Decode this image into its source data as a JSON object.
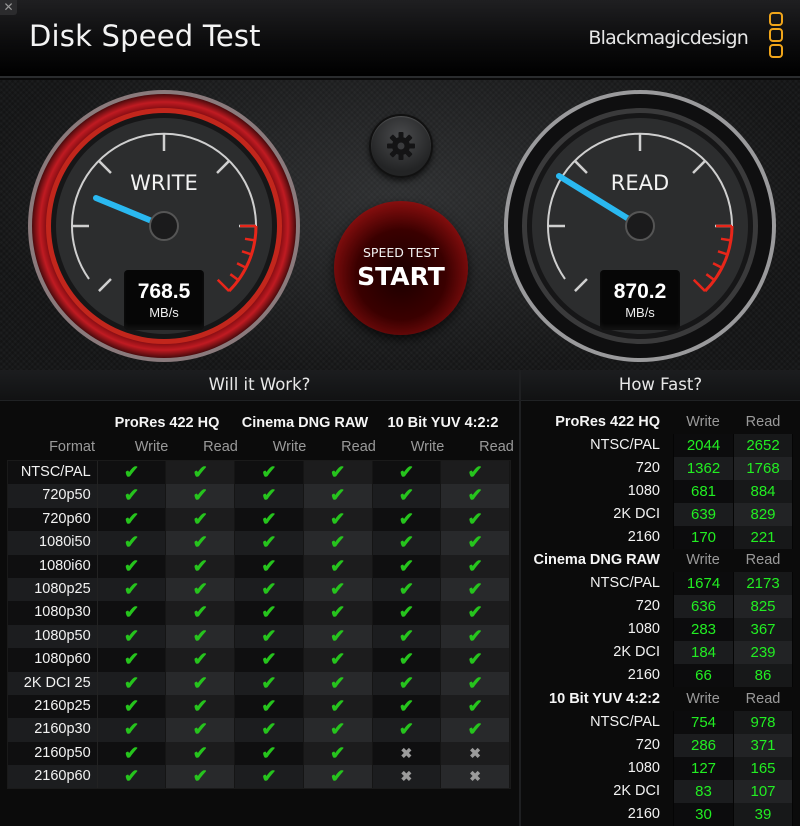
{
  "window": {
    "title": "Disk Speed Test",
    "close_icon": "close-icon",
    "brand": "Blackmagicdesign",
    "brand_logo_color": "#f0a51a"
  },
  "gauges": {
    "write": {
      "label": "WRITE",
      "value": "768.5",
      "unit": "MB/s",
      "ring_color": "#b1141a",
      "needle_color": "#2ab8f0"
    },
    "read": {
      "label": "READ",
      "value": "870.2",
      "unit": "MB/s",
      "ring_color": "#1a1a1a",
      "needle_color": "#2ab8f0"
    }
  },
  "controls": {
    "settings_icon": "gear-icon",
    "start_top": "SPEED TEST",
    "start_main": "START"
  },
  "will_it_work": {
    "title": "Will it Work?",
    "groups": [
      "ProRes 422 HQ",
      "Cinema DNG RAW",
      "10 Bit YUV 4:2:2"
    ],
    "format_header": "Format",
    "sub_headers": [
      "Write",
      "Read",
      "Write",
      "Read",
      "Write",
      "Read"
    ],
    "rows": [
      {
        "format": "NTSC/PAL",
        "results": [
          "ok",
          "ok",
          "ok",
          "ok",
          "ok",
          "ok"
        ]
      },
      {
        "format": "720p50",
        "results": [
          "ok",
          "ok",
          "ok",
          "ok",
          "ok",
          "ok"
        ]
      },
      {
        "format": "720p60",
        "results": [
          "ok",
          "ok",
          "ok",
          "ok",
          "ok",
          "ok"
        ]
      },
      {
        "format": "1080i50",
        "results": [
          "ok",
          "ok",
          "ok",
          "ok",
          "ok",
          "ok"
        ]
      },
      {
        "format": "1080i60",
        "results": [
          "ok",
          "ok",
          "ok",
          "ok",
          "ok",
          "ok"
        ]
      },
      {
        "format": "1080p25",
        "results": [
          "ok",
          "ok",
          "ok",
          "ok",
          "ok",
          "ok"
        ]
      },
      {
        "format": "1080p30",
        "results": [
          "ok",
          "ok",
          "ok",
          "ok",
          "ok",
          "ok"
        ]
      },
      {
        "format": "1080p50",
        "results": [
          "ok",
          "ok",
          "ok",
          "ok",
          "ok",
          "ok"
        ]
      },
      {
        "format": "1080p60",
        "results": [
          "ok",
          "ok",
          "ok",
          "ok",
          "ok",
          "ok"
        ]
      },
      {
        "format": "2K DCI 25",
        "results": [
          "ok",
          "ok",
          "ok",
          "ok",
          "ok",
          "ok"
        ]
      },
      {
        "format": "2160p25",
        "results": [
          "ok",
          "ok",
          "ok",
          "ok",
          "ok",
          "ok"
        ]
      },
      {
        "format": "2160p30",
        "results": [
          "ok",
          "ok",
          "ok",
          "ok",
          "ok",
          "ok"
        ]
      },
      {
        "format": "2160p50",
        "results": [
          "ok",
          "ok",
          "ok",
          "ok",
          "no",
          "no"
        ]
      },
      {
        "format": "2160p60",
        "results": [
          "ok",
          "ok",
          "ok",
          "ok",
          "no",
          "no"
        ]
      }
    ],
    "ok_glyph": "✔",
    "no_glyph": "✖",
    "ok_color": "#26c41d"
  },
  "how_fast": {
    "title": "How Fast?",
    "col_write": "Write",
    "col_read": "Read",
    "value_color": "#22ee22",
    "sections": [
      {
        "name": "ProRes 422 HQ",
        "rows": [
          {
            "label": "NTSC/PAL",
            "write": "2044",
            "read": "2652"
          },
          {
            "label": "720",
            "write": "1362",
            "read": "1768"
          },
          {
            "label": "1080",
            "write": "681",
            "read": "884"
          },
          {
            "label": "2K DCI",
            "write": "639",
            "read": "829"
          },
          {
            "label": "2160",
            "write": "170",
            "read": "221"
          }
        ]
      },
      {
        "name": "Cinema DNG RAW",
        "rows": [
          {
            "label": "NTSC/PAL",
            "write": "1674",
            "read": "2173"
          },
          {
            "label": "720",
            "write": "636",
            "read": "825"
          },
          {
            "label": "1080",
            "write": "283",
            "read": "367"
          },
          {
            "label": "2K DCI",
            "write": "184",
            "read": "239"
          },
          {
            "label": "2160",
            "write": "66",
            "read": "86"
          }
        ]
      },
      {
        "name": "10 Bit YUV 4:2:2",
        "rows": [
          {
            "label": "NTSC/PAL",
            "write": "754",
            "read": "978"
          },
          {
            "label": "720",
            "write": "286",
            "read": "371"
          },
          {
            "label": "1080",
            "write": "127",
            "read": "165"
          },
          {
            "label": "2K DCI",
            "write": "83",
            "read": "107"
          },
          {
            "label": "2160",
            "write": "30",
            "read": "39"
          }
        ]
      }
    ]
  }
}
